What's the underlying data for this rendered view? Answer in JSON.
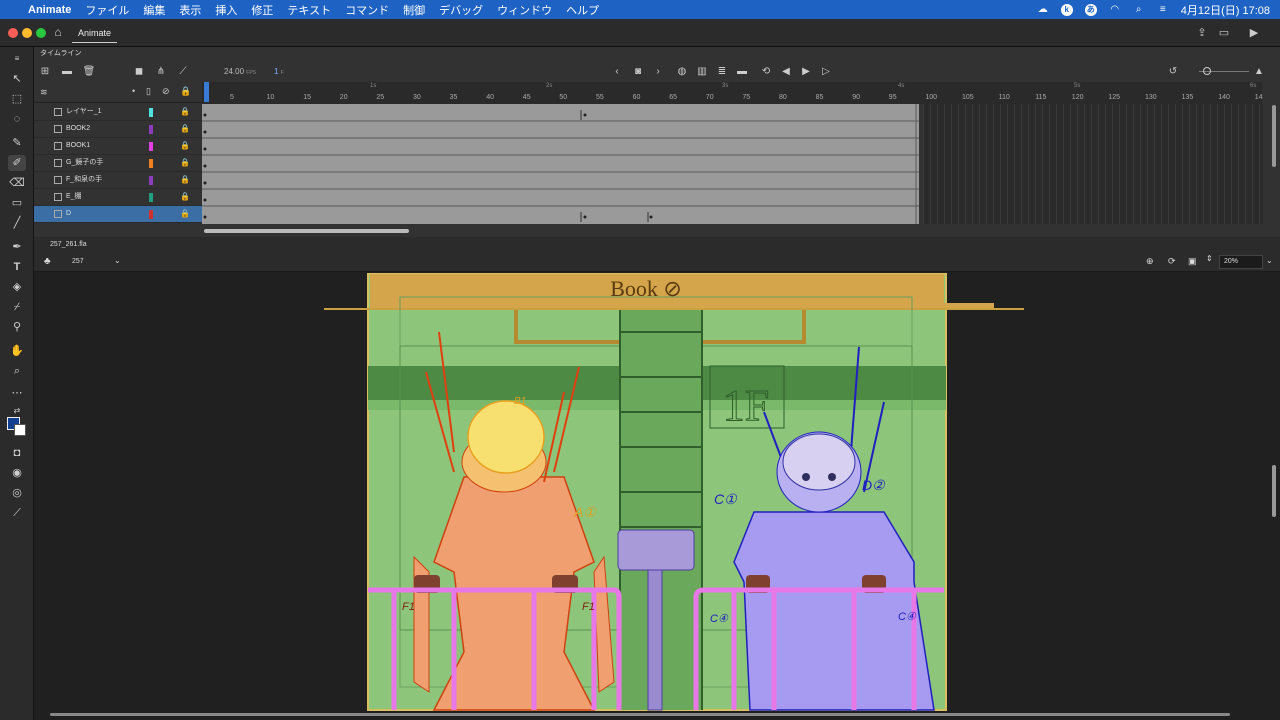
{
  "menubar": {
    "apple": "",
    "app_name": "Animate",
    "items": [
      "ファイル",
      "編集",
      "表示",
      "挿入",
      "修正",
      "テキスト",
      "コマンド",
      "制御",
      "デバッグ",
      "ウィンドウ",
      "ヘルプ"
    ],
    "clock": "4月12日(日)  17:08"
  },
  "titlebar": {
    "tab_label": "Animate"
  },
  "timeline": {
    "panel_title": "タイムライン",
    "fps": "24.00",
    "fps_unit": "FPS",
    "current_frame": "1",
    "frame_unit": "F",
    "ruler_ticks": [
      "5",
      "10",
      "15",
      "20",
      "25",
      "30",
      "35",
      "40",
      "45",
      "50",
      "55",
      "60",
      "65",
      "70",
      "75",
      "80",
      "85",
      "90",
      "95",
      "100",
      "105",
      "110",
      "115",
      "120",
      "125",
      "130",
      "135",
      "140",
      "14"
    ],
    "ruler_seconds": [
      "1s",
      "2s",
      "3s",
      "4s",
      "5s",
      "6s"
    ],
    "layers": [
      {
        "name": "レイヤー_1",
        "color": "#4fe0e0"
      },
      {
        "name": "BOOK2",
        "color": "#8b3dbd"
      },
      {
        "name": "BOOK1",
        "color": "#e040e0"
      },
      {
        "name": "G_鏡子の手",
        "color": "#f08020"
      },
      {
        "name": "F_和泉の手",
        "color": "#8b3dbd"
      },
      {
        "name": "E_棚",
        "color": "#20a080"
      },
      {
        "name": "D",
        "color": "#d03030"
      }
    ]
  },
  "document": {
    "filename": "257_261.fla",
    "scene": "257",
    "zoom": "20%"
  },
  "stage": {
    "sign_text": "Book ⊘",
    "floor_sign": "1F",
    "notes": [
      "A①",
      "C①",
      "D②",
      "F1",
      "F1",
      "C④",
      "C④",
      "B1"
    ]
  }
}
